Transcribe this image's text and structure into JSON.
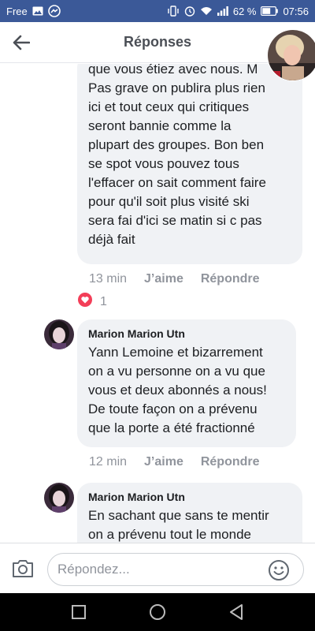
{
  "status_bar": {
    "carrier": "Free",
    "battery": "62 %",
    "time": "07:56"
  },
  "header": {
    "title": "Réponses"
  },
  "comments": [
    {
      "lines": [
        "que vous étiez avec nous. M",
        "Pas grave on publira plus rien",
        "ici et tout ceux qui critiques",
        "seront bannie comme la",
        "plupart des groupes. Bon ben",
        "se spot vous pouvez tous",
        "l'effacer on sait comment faire",
        "pour qu'il soit plus visité ski",
        "sera fai d'ici se matin si c pas",
        "déjà fait"
      ],
      "time": "13 min",
      "like_label": "J’aime",
      "reply_label": "Répondre",
      "reaction_count": "1"
    },
    {
      "author": "Marion Marion Utn",
      "lines": [
        "Yann Lemoine et bizarrement",
        "on a vu personne on a vu que",
        "vous et deux abonnés a nous!",
        "De toute façon on a prévenu",
        "que la porte a été fractionné"
      ],
      "time": "12 min",
      "like_label": "J’aime",
      "reply_label": "Répondre"
    },
    {
      "author": "Marion Marion Utn",
      "lines": [
        "En sachant que sans te mentir",
        "on a prévenu tout le monde"
      ]
    }
  ],
  "composer": {
    "placeholder": "Répondez..."
  },
  "colors": {
    "status_bar": "#3b5998",
    "bubble": "#f0f2f5",
    "meta_text": "#90949c",
    "reaction_heart": "#f33e58"
  }
}
